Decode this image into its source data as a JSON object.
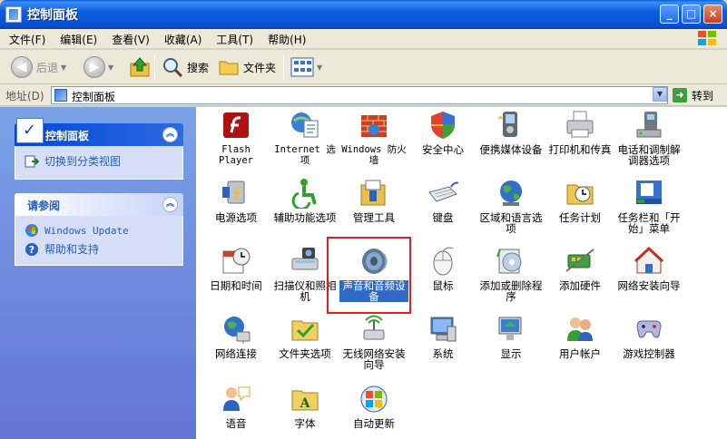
{
  "window": {
    "title": "控制面板",
    "min_label": "_",
    "max_label": "□",
    "close_label": "×"
  },
  "menu": [
    "文件(F)",
    "编辑(E)",
    "查看(V)",
    "收藏(A)",
    "工具(T)",
    "帮助(H)"
  ],
  "toolbar": {
    "back_label": "后退",
    "back_glyph": "◀",
    "forward_glyph": "▶",
    "search_label": "搜索",
    "folders_label": "文件夹"
  },
  "address": {
    "label": "地址(D)",
    "value": "控制面板",
    "go_label": "转到"
  },
  "taskpane": {
    "panel1": {
      "title": "控制面板",
      "link": "切换到分类视图"
    },
    "panel2": {
      "title": "请参阅",
      "links": [
        "Windows Update",
        "帮助和支持"
      ]
    }
  },
  "items": [
    {
      "name": "Flash Player",
      "icon": "flash-icon"
    },
    {
      "name": "Internet 选项",
      "icon": "internet-options-icon"
    },
    {
      "name": "Windows 防火墙",
      "icon": "firewall-icon"
    },
    {
      "name": "安全中心",
      "icon": "shield-icon"
    },
    {
      "name": "便携媒体设备",
      "icon": "media-device-icon"
    },
    {
      "name": "打印机和传真",
      "icon": "printer-icon"
    },
    {
      "name": "电话和调制解调器选项",
      "icon": "phone-modem-icon"
    },
    {
      "name": "电源选项",
      "icon": "power-icon"
    },
    {
      "name": "辅助功能选项",
      "icon": "accessibility-icon"
    },
    {
      "name": "管理工具",
      "icon": "admin-tools-icon"
    },
    {
      "name": "键盘",
      "icon": "keyboard-icon"
    },
    {
      "name": "区域和语言选项",
      "icon": "globe-icon"
    },
    {
      "name": "任务计划",
      "icon": "scheduled-tasks-icon"
    },
    {
      "name": "任务栏和「开始」菜单",
      "icon": "taskbar-icon"
    },
    {
      "name": "日期和时间",
      "icon": "clock-icon"
    },
    {
      "name": "扫描仪和照相机",
      "icon": "scanner-icon"
    },
    {
      "name": "声音和音频设备",
      "icon": "speaker-icon"
    },
    {
      "name": "鼠标",
      "icon": "mouse-icon"
    },
    {
      "name": "添加或删除程序",
      "icon": "add-remove-icon"
    },
    {
      "name": "添加硬件",
      "icon": "add-hardware-icon"
    },
    {
      "name": "网络安装向导",
      "icon": "network-setup-icon"
    },
    {
      "name": "网络连接",
      "icon": "network-connections-icon"
    },
    {
      "name": "文件夹选项",
      "icon": "folder-options-icon"
    },
    {
      "name": "无线网络安装向导",
      "icon": "wireless-icon"
    },
    {
      "name": "系统",
      "icon": "system-icon"
    },
    {
      "name": "显示",
      "icon": "display-icon"
    },
    {
      "name": "用户帐户",
      "icon": "user-accounts-icon"
    },
    {
      "name": "游戏控制器",
      "icon": "gamepad-icon"
    },
    {
      "name": "语音",
      "icon": "speech-icon"
    },
    {
      "name": "字体",
      "icon": "fonts-icon"
    },
    {
      "name": "自动更新",
      "icon": "windows-update-icon"
    }
  ],
  "colors": {
    "accent": "#316ac5",
    "highlight_box": "#e02020",
    "pane_top": "#7ba2e7",
    "pane_bottom": "#6375d6"
  }
}
